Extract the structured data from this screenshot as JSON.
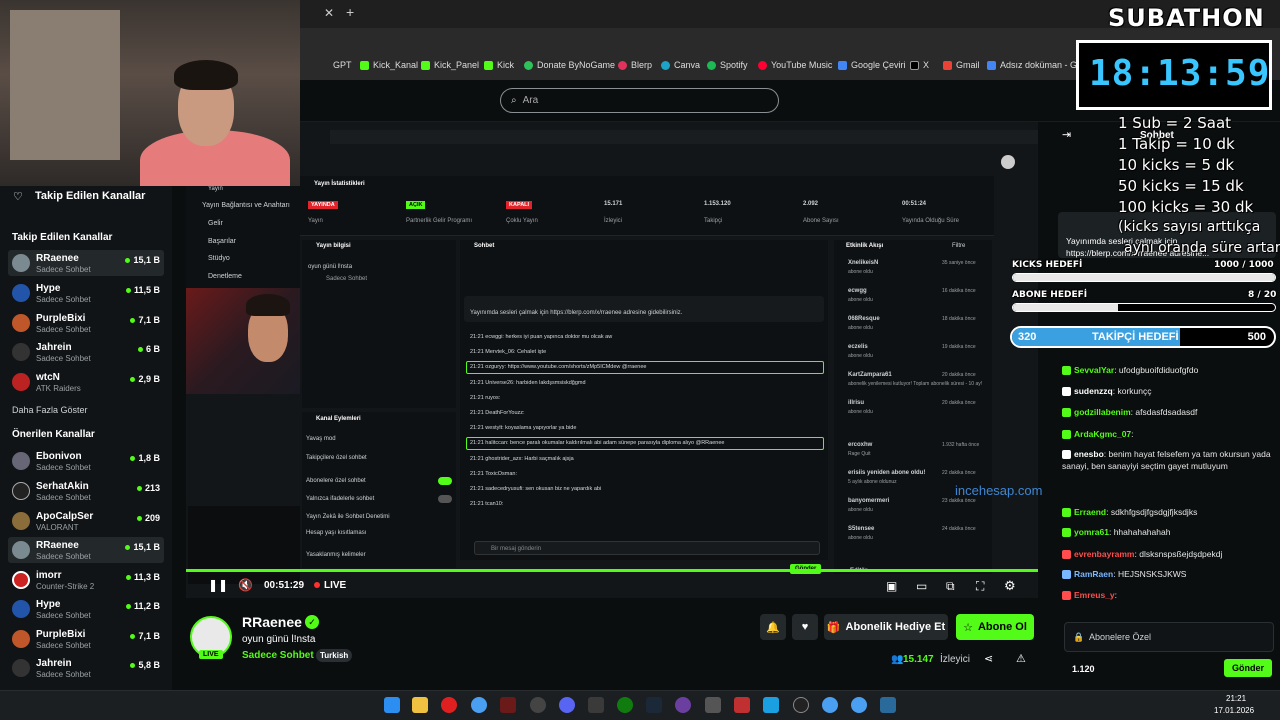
{
  "browser": {
    "new_tab": "+",
    "bookmarks": [
      "GPT",
      "Kick_Kanal",
      "Kick_Panel",
      "Kick",
      "Donate ByNoGame",
      "Blerp",
      "Canva",
      "Spotify",
      "YouTube Music",
      "Google Çeviri",
      "X",
      "Gmail",
      "Adsız doküman - G..."
    ]
  },
  "search": {
    "placeholder": "Ara"
  },
  "sidebar": {
    "followed_title": "Takip Edilen Kanallar",
    "followed_header": "Takip Edilen Kanallar",
    "followed": [
      {
        "name": "RRaenee",
        "category": "Sadece Sohbet",
        "viewers": "15,1 B"
      },
      {
        "name": "Hype",
        "category": "Sadece Sohbet",
        "viewers": "11,5 B"
      },
      {
        "name": "PurpleBixi",
        "category": "Sadece Sohbet",
        "viewers": "7,1 B"
      },
      {
        "name": "Jahrein",
        "category": "Sadece Sohbet",
        "viewers": "6 B"
      },
      {
        "name": "wtcN",
        "category": "ATK Raiders",
        "viewers": "2,9 B"
      }
    ],
    "more": "Daha Fazla Göster",
    "recommended_header": "Önerilen Kanallar",
    "recommended": [
      {
        "name": "Ebonivon",
        "category": "Sadece Sohbet",
        "viewers": "1,8 B"
      },
      {
        "name": "SerhatAkin",
        "category": "Sadece Sohbet",
        "viewers": "213"
      },
      {
        "name": "ApoCalpSer",
        "category": "VALORANT",
        "viewers": "209"
      },
      {
        "name": "RRaenee",
        "category": "Sadece Sohbet",
        "viewers": "15,1 B"
      },
      {
        "name": "imorr",
        "category": "Counter-Strike 2",
        "viewers": "11,3 B"
      },
      {
        "name": "Hype",
        "category": "Sadece Sohbet",
        "viewers": "11,2 B"
      },
      {
        "name": "PurpleBixi",
        "category": "Sadece Sohbet",
        "viewers": "7,1 B"
      },
      {
        "name": "Jahrein",
        "category": "Sadece Sohbet",
        "viewers": "5,8 B"
      }
    ]
  },
  "dashboard": {
    "menu": [
      "Yayın",
      "Yayın Bağlantısı ve Anahtarı",
      "Gelir",
      "Başarılar",
      "Stüdyo",
      "Denetleme"
    ],
    "stats_title": "Yayın İstatistikleri",
    "stats": [
      {
        "value": "YAYINDA",
        "label": "Yayın"
      },
      {
        "value": "AÇIK",
        "label": "Partnerlik Gelir Programı"
      },
      {
        "value": "KAPALI",
        "label": "Çoklu Yayın"
      },
      {
        "value": "15.171",
        "label": "İzleyici"
      },
      {
        "value": "1.153.120",
        "label": "Takipçi"
      },
      {
        "value": "2.092",
        "label": "Abone Sayısı"
      },
      {
        "value": "00:51:24",
        "label": "Yayında Olduğu Süre"
      }
    ],
    "info_title": "Yayın bilgisi",
    "info_stream_title": "oyun günü l!nsta",
    "info_category": "Sadece Sohbet",
    "chat_title": "Sohbet",
    "pinned": "Yayınımda sesleri çalmak için https://blerp.com/x/rraenee adresine gidebilirsiniz.",
    "chat": [
      "21:21 ecwggi: herkes iyi puan yapınca doktor mu olcak aw",
      "21:21 Mervtek_06: Cehalet işte",
      "21:21 ozguryy: https://www.youtube.com/shorts/zMp5ICMdew @rraenee",
      "21:21 Universe26: harbiden lakdşsmsiskdğgmd",
      "21:21 ruyos:",
      "21:21 DeathForYouzz:",
      "21:21 westylt: koyaslama yapıyorlar ya bide",
      "21:21 halitccan: bence paralı okumalar kaldırılmalı abi adam sünepe parasıyla diploma alıyo @RRaenee",
      "21:21 ghostrider_azx: Harbi saçmalık ajsja",
      "21:21 ToxicOsman:",
      "21:21 sadecedryusufi: sen okusan biz ne yapardık abi",
      "21:21 tcan10:"
    ],
    "chat_input": "Bir mesaj gönderin",
    "send": "Gönder",
    "actions_title": "Kanal Eylemleri",
    "actions": [
      "Yavaş mod",
      "Takipçilere özel sohbet",
      "Abonelere özel sohbet",
      "Yalnızca ifadelerle sohbet",
      "Yayın Zekâ ile Sohbet Denetimi",
      "Hesap yaşı kısıtlaması",
      "Yasaklanmış kelimeler"
    ],
    "activity_title": "Etkinlik Akışı",
    "activity_filter": "Filtre",
    "activity": [
      {
        "name": "XnelikeisN",
        "sub": "abone oldu",
        "time": "35 saniye önce"
      },
      {
        "name": "ecwgg",
        "sub": "abone oldu",
        "time": "16 dakika önce"
      },
      {
        "name": "068Resque",
        "sub": "abone oldu",
        "time": "18 dakika önce"
      },
      {
        "name": "eczelis",
        "sub": "abone oldu",
        "time": "19 dakika önce"
      },
      {
        "name": "KartZampara61",
        "sub": "abonelik yenilemesi kutluyor! Toplam abonelik süresi - 10 ay!",
        "time": "20 dakika önce"
      },
      {
        "name": "illrisu",
        "sub": "abone oldu",
        "time": "20 dakika önce"
      },
      {
        "name": "ercoxhw",
        "sub": "Rage Quit",
        "time": "1.932 hafta önce"
      },
      {
        "name": "erisiis yeniden abone oldu!",
        "sub": "5 aylık abone oldunuz",
        "time": "22 dakika önce"
      },
      {
        "name": "banyomermeri",
        "sub": "abone oldu",
        "time": "23 dakika önce"
      },
      {
        "name": "S5tensee",
        "sub": "abone oldu",
        "time": "24 dakika önce"
      }
    ],
    "editor": "Editör",
    "watermark": "incehesap.com"
  },
  "player": {
    "time": "00:51:29",
    "live": "LIVE"
  },
  "channel": {
    "name": "RRaenee",
    "title": "oyun günü l!nsta",
    "category": "Sadece Sohbet",
    "tag": "Turkish",
    "avatar_badge": "LIVE",
    "gift": "Abonelik Hediye Et",
    "subscribe": "Abone Ol",
    "viewers": "15.147",
    "viewers_label": "İzleyici"
  },
  "chat": {
    "header": "Sohbet",
    "pinned_line1": "Yayınımda sesleri çalmak için",
    "pinned_line2": "https://blerp.com/x/rraenee adresine...",
    "messages": [
      {
        "user": "SevvalYar",
        "text": "ufodgbuoifdiduofgfdo",
        "color": "#53fc18"
      },
      {
        "user": "sudenzzq",
        "text": "korkunçç",
        "color": "#ffffff"
      },
      {
        "user": "godzillabenim",
        "text": "afsdasfdsadasdf",
        "color": "#53fc18"
      },
      {
        "user": "ArdaKgmc_07",
        "text": "",
        "color": "#53fc18"
      },
      {
        "user": "enesbo",
        "text": "benim hayat felsefem ya tam okursun yada sanayi, ben sanayiyi seçtim gayet mutluyum",
        "color": "#ffffff"
      },
      {
        "user": "Erraend",
        "text": "sdkhfgsdjfgsdgjfjksdjks",
        "color": "#53fc18"
      },
      {
        "user": "yomra61",
        "text": "hhahahahahah",
        "color": "#53fc18"
      },
      {
        "user": "evrenbayramm",
        "text": "dlsksnspsßejdşdpekdj",
        "color": "#ff4d4d"
      },
      {
        "user": "RamRaen",
        "text": "HEJSNSKSJKWS",
        "color": "#7ab8ff"
      },
      {
        "user": "Emreus_y",
        "text": "",
        "color": "#ff4d4d"
      }
    ],
    "input_placeholder": "Abonelere Özel",
    "points": "1.120",
    "send": "Gönder"
  },
  "overlay": {
    "subathon": "SUBATHON",
    "timer": "18:13:59",
    "rules": [
      "1 Sub = 2 Saat",
      "1 Takip = 10 dk",
      "10 kicks = 5 dk",
      "50 kicks = 15 dk",
      "100 kicks = 30 dk"
    ],
    "note_line1": "(kicks sayısı arttıkça",
    "note_line2": "aynı oranda süre artar)",
    "goals": [
      {
        "label": "KICKS HEDEFİ",
        "current": "1000",
        "target": "1000",
        "fraction": 1.0
      },
      {
        "label": "ABONE HEDEFİ",
        "current": "8",
        "target": "20",
        "fraction": 0.4
      },
      {
        "label": "TAKİPÇİ HEDEFİ",
        "current": "320",
        "target": "500",
        "fraction": 0.64
      }
    ]
  },
  "taskbar": {
    "time": "21:21",
    "date": "17.01.2026"
  }
}
